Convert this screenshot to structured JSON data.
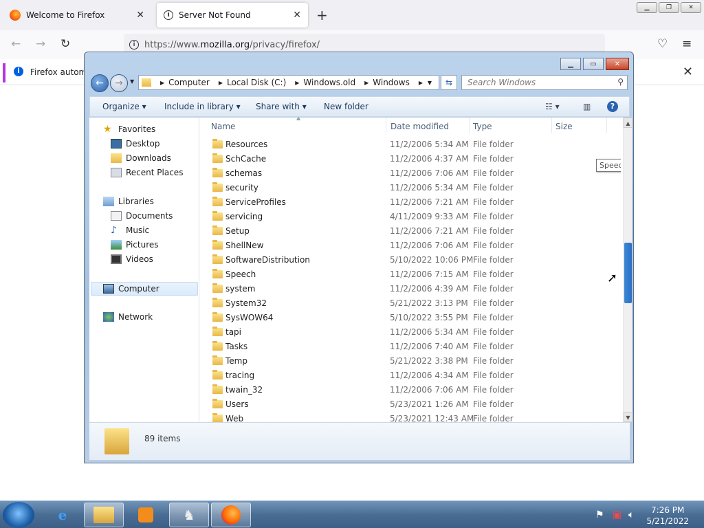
{
  "firefox": {
    "tabs": [
      {
        "title": "Welcome to Firefox"
      },
      {
        "title": "Server Not Found"
      }
    ],
    "url_prefix": "https://www.",
    "url_domain": "mozilla.org",
    "url_path": "/privacy/firefox/",
    "notification": "Firefox automa"
  },
  "explorer": {
    "breadcrumb": [
      "Computer",
      "Local Disk (C:)",
      "Windows.old",
      "Windows"
    ],
    "search_placeholder": "Search Windows",
    "commands": {
      "organize": "Organize",
      "include": "Include in library",
      "share": "Share with",
      "new_folder": "New folder"
    },
    "nav": {
      "favorites": "Favorites",
      "favorites_items": [
        "Desktop",
        "Downloads",
        "Recent Places"
      ],
      "libraries": "Libraries",
      "libraries_items": [
        "Documents",
        "Music",
        "Pictures",
        "Videos"
      ],
      "computer": "Computer",
      "network": "Network"
    },
    "columns": {
      "name": "Name",
      "date": "Date modified",
      "type": "Type",
      "size": "Size"
    },
    "rows": [
      {
        "name": "Resources",
        "date": "11/2/2006 5:34 AM",
        "type": "File folder"
      },
      {
        "name": "SchCache",
        "date": "11/2/2006 4:37 AM",
        "type": "File folder"
      },
      {
        "name": "schemas",
        "date": "11/2/2006 7:06 AM",
        "type": "File folder"
      },
      {
        "name": "security",
        "date": "11/2/2006 5:34 AM",
        "type": "File folder"
      },
      {
        "name": "ServiceProfiles",
        "date": "11/2/2006 7:21 AM",
        "type": "File folder"
      },
      {
        "name": "servicing",
        "date": "4/11/2009 9:33 AM",
        "type": "File folder"
      },
      {
        "name": "Setup",
        "date": "11/2/2006 7:21 AM",
        "type": "File folder"
      },
      {
        "name": "ShellNew",
        "date": "11/2/2006 7:06 AM",
        "type": "File folder"
      },
      {
        "name": "SoftwareDistribution",
        "date": "5/10/2022 10:06 PM",
        "type": "File folder"
      },
      {
        "name": "Speech",
        "date": "11/2/2006 7:15 AM",
        "type": "File folder"
      },
      {
        "name": "system",
        "date": "11/2/2006 4:39 AM",
        "type": "File folder"
      },
      {
        "name": "System32",
        "date": "5/21/2022 3:13 PM",
        "type": "File folder"
      },
      {
        "name": "SysWOW64",
        "date": "5/10/2022 3:55 PM",
        "type": "File folder"
      },
      {
        "name": "tapi",
        "date": "11/2/2006 5:34 AM",
        "type": "File folder"
      },
      {
        "name": "Tasks",
        "date": "11/2/2006 7:40 AM",
        "type": "File folder"
      },
      {
        "name": "Temp",
        "date": "5/21/2022 3:38 PM",
        "type": "File folder"
      },
      {
        "name": "tracing",
        "date": "11/2/2006 4:34 AM",
        "type": "File folder"
      },
      {
        "name": "twain_32",
        "date": "11/2/2006 7:06 AM",
        "type": "File folder"
      },
      {
        "name": "Users",
        "date": "5/23/2021 1:26 AM",
        "type": "File folder"
      },
      {
        "name": "Web",
        "date": "5/23/2021 12:43 AM",
        "type": "File folder"
      }
    ],
    "tooltip": "Speech",
    "status": "89 items"
  },
  "taskbar": {
    "time": "7:26 PM",
    "date": "5/21/2022"
  }
}
